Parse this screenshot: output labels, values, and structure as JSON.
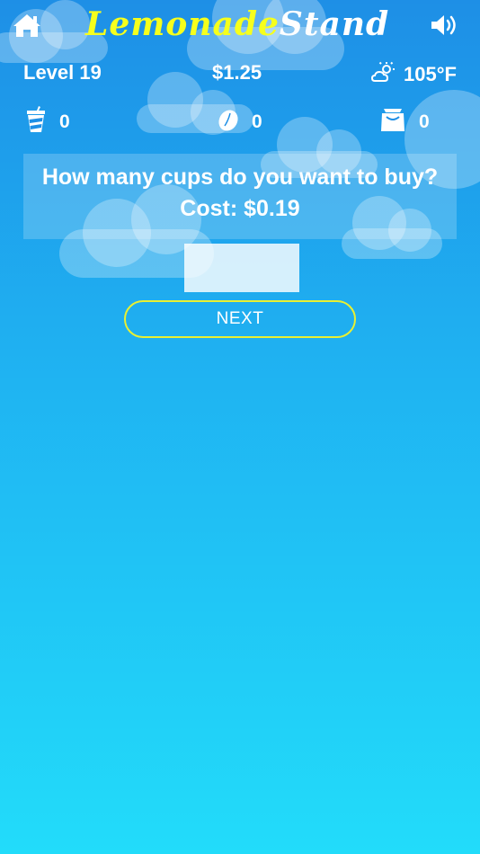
{
  "header": {
    "title_part1": "Lemonade",
    "title_part2": "Stand",
    "home_icon": "home-icon",
    "sound_icon": "speaker-icon"
  },
  "stats": {
    "level": "Level 19",
    "money": "$1.25",
    "weather_icon": "partly-cloudy-sun-icon",
    "temperature": "105°F"
  },
  "inventory": {
    "cups": {
      "icon": "cup-icon",
      "count": "0"
    },
    "lemons": {
      "icon": "lemon-icon",
      "count": "0"
    },
    "sugar": {
      "icon": "sugar-bag-icon",
      "count": "0"
    }
  },
  "prompt": {
    "question": "How many cups do you want to buy?",
    "cost": "Cost: $0.19"
  },
  "quantity_input": {
    "value": ""
  },
  "next_button": {
    "label": "NEXT"
  },
  "colors": {
    "sky_top": "#1e8fe6",
    "sky_bottom": "#22dcfa",
    "title_yellow": "#f6ff1c",
    "button_border": "#e9f032"
  }
}
